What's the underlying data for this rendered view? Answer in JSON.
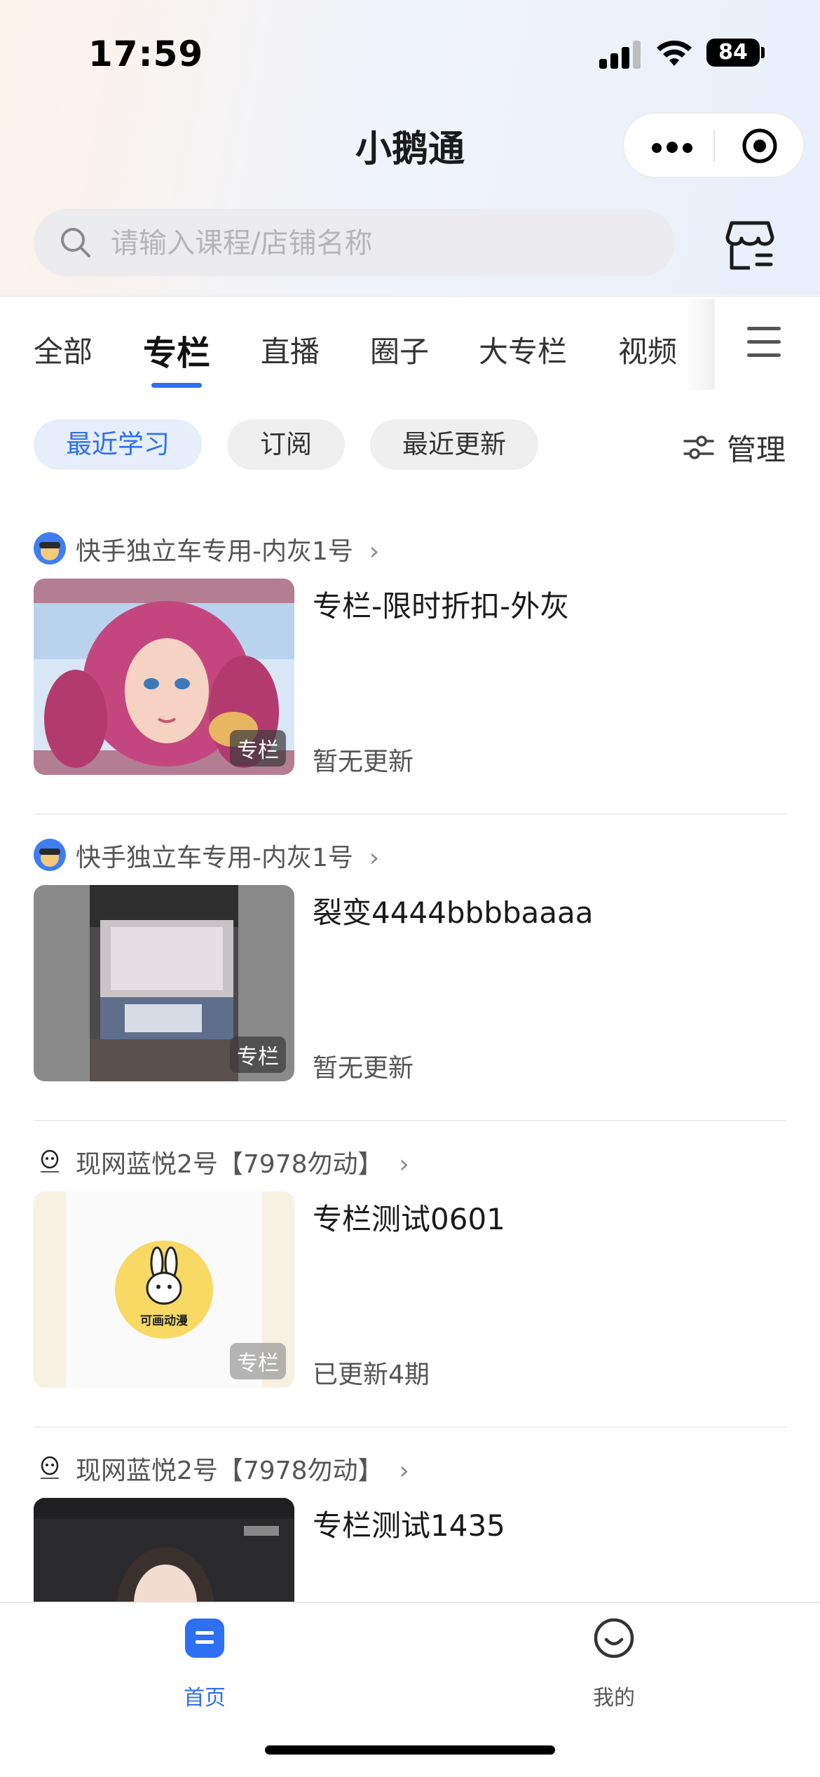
{
  "status_bar": {
    "time": "17:59",
    "battery": "84"
  },
  "nav": {
    "title": "小鹅通"
  },
  "search": {
    "placeholder": "请输入课程/店铺名称"
  },
  "tabs": [
    {
      "label": "全部",
      "active": false
    },
    {
      "label": "专栏",
      "active": true
    },
    {
      "label": "直播",
      "active": false
    },
    {
      "label": "圈子",
      "active": false
    },
    {
      "label": "大专栏",
      "active": false
    },
    {
      "label": "视频",
      "active": false
    }
  ],
  "filters": [
    {
      "label": "最近学习",
      "active": true
    },
    {
      "label": "订阅",
      "active": false
    },
    {
      "label": "最近更新",
      "active": false
    }
  ],
  "manage_label": "管理",
  "items": [
    {
      "shop": "快手独立车专用-内灰1号",
      "title": "专栏-限时折扣-外灰",
      "status": "暂无更新",
      "badge": "专栏",
      "thumb_icon": "pink-hair-character-image"
    },
    {
      "shop": "快手独立车专用-内灰1号",
      "title": "裂变4444bbbbaaaa",
      "status": "暂无更新",
      "badge": "专栏",
      "thumb_icon": "station-display-photo"
    },
    {
      "shop": "现网蓝悦2号【7978勿动】",
      "title": "专栏测试0601",
      "status": "已更新4期",
      "badge": "专栏",
      "thumb_icon": "rabbit-logo",
      "thumb_caption": "可画动漫"
    },
    {
      "shop": "现网蓝悦2号【7978勿动】",
      "title": "专栏测试1435",
      "status": "",
      "badge": "",
      "thumb_icon": "portrait-photo"
    }
  ],
  "bottom_nav": [
    {
      "label": "首页",
      "active": true
    },
    {
      "label": "我的",
      "active": false
    }
  ],
  "colors": {
    "accent": "#2f6ff2",
    "active_filter_bg": "#e6eefc"
  }
}
